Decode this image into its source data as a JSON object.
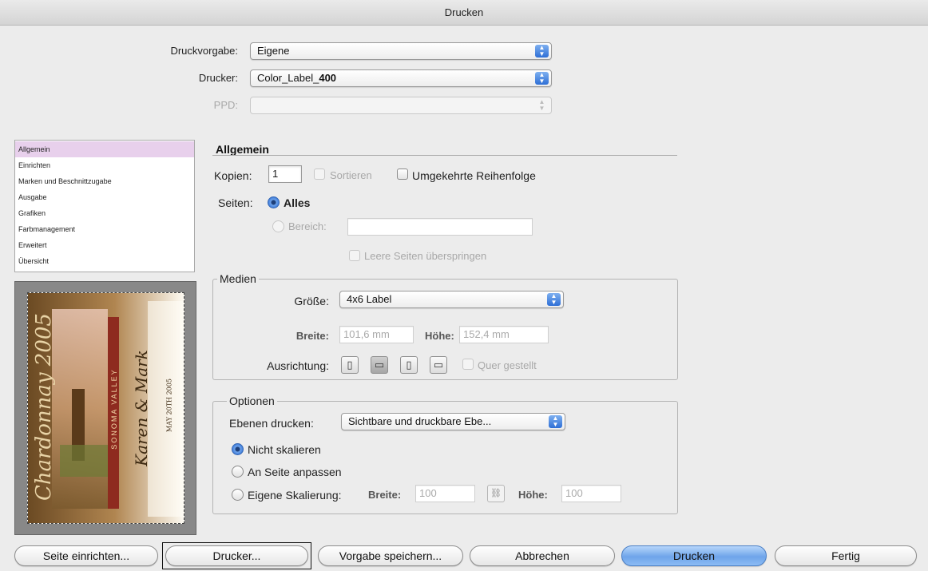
{
  "window": {
    "title": "Drucken"
  },
  "header": {
    "preset_label": "Druckvorgabe:",
    "preset_value": "Eigene",
    "printer_label": "Drucker:",
    "printer_value_prefix": "Color_Label_",
    "printer_value_bold": "400",
    "ppd_label": "PPD:",
    "ppd_value": ""
  },
  "sidebar": {
    "items": [
      {
        "label": "Allgemein",
        "selected": true
      },
      {
        "label": "Einrichten"
      },
      {
        "label": "Marken und Beschnittzugabe"
      },
      {
        "label": "Ausgabe"
      },
      {
        "label": "Grafiken"
      },
      {
        "label": "Farbmanagement"
      },
      {
        "label": "Erweitert"
      },
      {
        "label": "Übersicht"
      }
    ]
  },
  "preview": {
    "title_script": "Chardonnay 2005",
    "band_text": "SONOMA VALLEY",
    "names": "Karen & Mark",
    "date": "MAY 20TH 2005"
  },
  "general": {
    "section_title": "Allgemein",
    "copies_label": "Kopien:",
    "copies_value": "1",
    "collate_label": "Sortieren",
    "reverse_label": "Umgekehrte Reihenfolge",
    "pages_label": "Seiten:",
    "all_label": "Alles",
    "range_label": "Bereich:",
    "range_value": "",
    "skip_blank_label": "Leere Seiten überspringen"
  },
  "media": {
    "group_title": "Medien",
    "size_label": "Größe:",
    "size_value": "4x6 Label",
    "width_label": "Breite:",
    "width_value": "101,6 mm",
    "height_label": "Höhe:",
    "height_value": "152,4 mm",
    "orientation_label": "Ausrichtung:",
    "transverse_label": "Quer gestellt"
  },
  "options": {
    "group_title": "Optionen",
    "layers_label": "Ebenen drucken:",
    "layers_value": "Sichtbare und druckbare Ebe...",
    "no_scale_label": "Nicht skalieren",
    "fit_label": "An Seite anpassen",
    "custom_scale_label": "Eigene Skalierung:",
    "scale_width_label": "Breite:",
    "scale_width_value": "100",
    "scale_height_label": "Höhe:",
    "scale_height_value": "100"
  },
  "footer": {
    "page_setup": "Seite einrichten...",
    "printer": "Drucker...",
    "save_preset": "Vorgabe speichern...",
    "cancel": "Abbrechen",
    "print": "Drucken",
    "done": "Fertig"
  },
  "colors": {
    "default_button": "#6ea4ea",
    "sidebar_selected": "#e8d0ec",
    "dialog_bg": "#ececec"
  }
}
